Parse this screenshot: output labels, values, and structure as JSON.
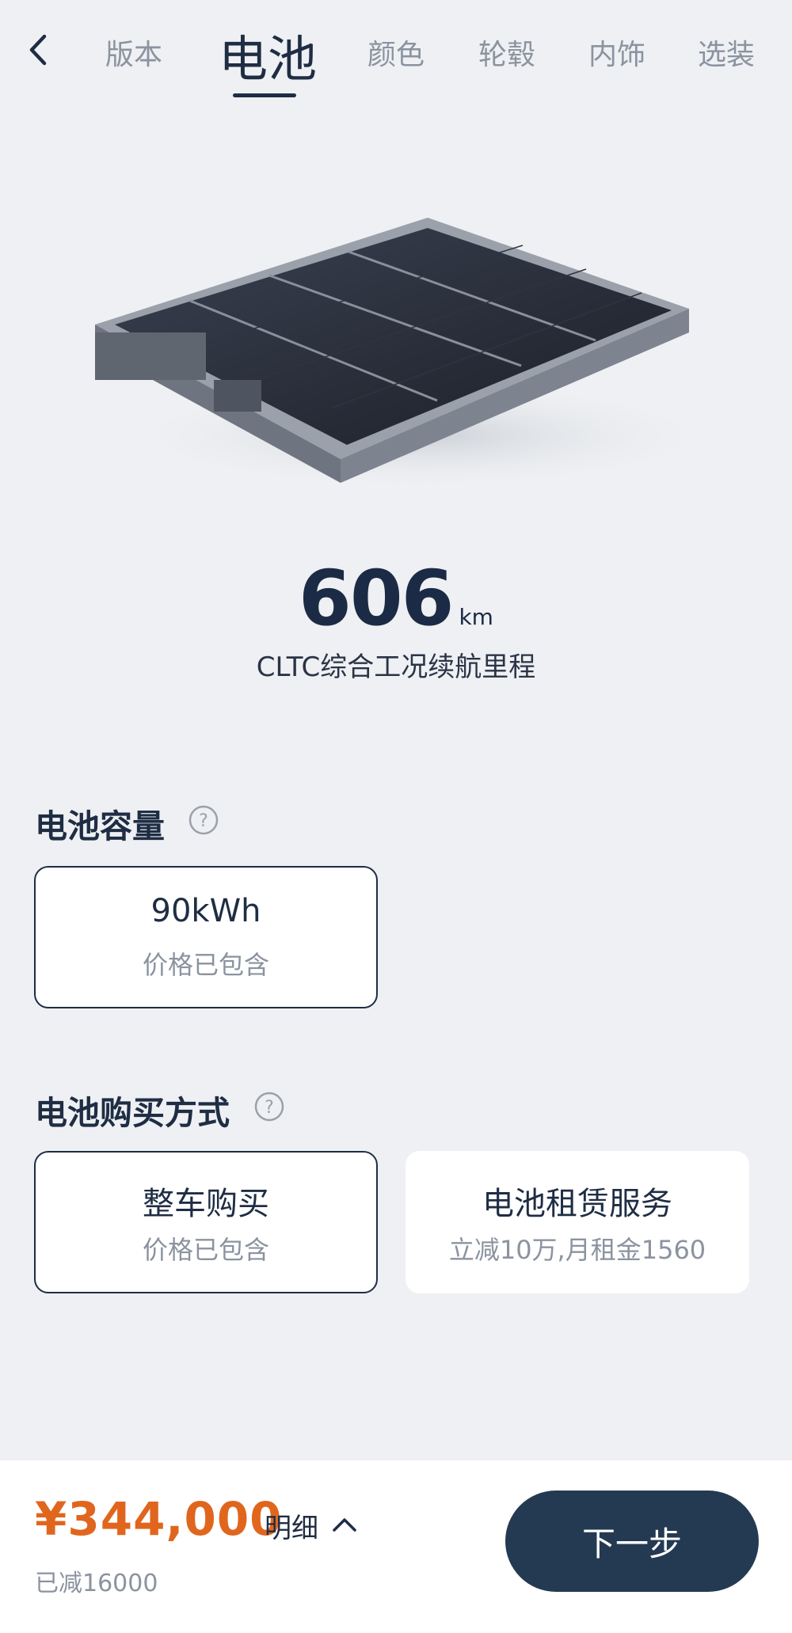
{
  "nav": {
    "tabs": [
      {
        "label": "版本"
      },
      {
        "label": "电池"
      },
      {
        "label": "颜色"
      },
      {
        "label": "轮毂"
      },
      {
        "label": "内饰"
      },
      {
        "label": "选装"
      }
    ],
    "active_tab": "电池"
  },
  "range": {
    "value": "606",
    "unit": "km",
    "label": "CLTC综合工况续航里程"
  },
  "capacity": {
    "title": "电池容量",
    "options": [
      {
        "title": "90kWh",
        "subtitle": "价格已包含",
        "selected": true
      }
    ]
  },
  "purchase": {
    "title": "电池购买方式",
    "options": [
      {
        "title": "整车购买",
        "subtitle": "价格已包含",
        "selected": true
      },
      {
        "title": "电池租赁服务",
        "subtitle": "立减10万,月租金1560",
        "selected": false
      }
    ]
  },
  "footer": {
    "price": "¥344,000",
    "detail_label": "明细",
    "discount": "已减16000",
    "next_label": "下一步"
  },
  "colors": {
    "primary": "#1f2d44",
    "price": "#e0661e",
    "button": "#243a52",
    "background": "#eef0f3"
  }
}
